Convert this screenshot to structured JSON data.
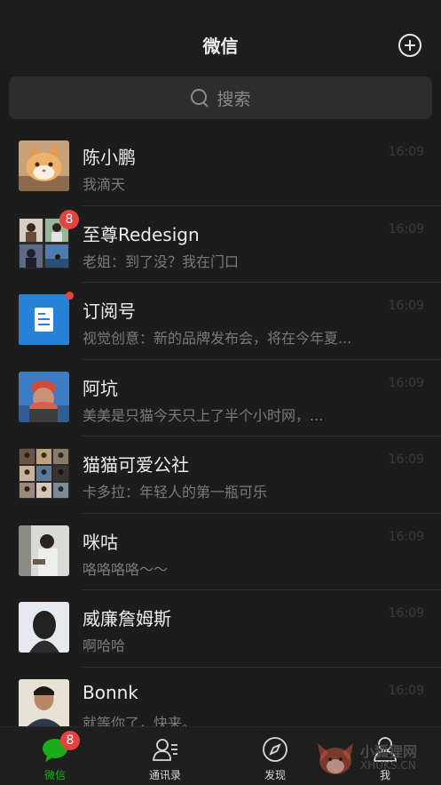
{
  "header": {
    "title": "微信"
  },
  "search": {
    "placeholder": "搜索"
  },
  "chats": [
    {
      "name": "陈小鹏",
      "message": "我滴天",
      "time": "16:09"
    },
    {
      "name": "至尊Redesign",
      "message": "老姐：到了没？我在门口",
      "time": "16:09",
      "badge": "8"
    },
    {
      "name": "订阅号",
      "message": "视觉创意：新的品牌发布会，将在今年夏...",
      "time": "16:09"
    },
    {
      "name": "阿坑",
      "message": "美美是只猫今天只上了半个小时网，...",
      "time": "16:09"
    },
    {
      "name": "猫猫可爱公社",
      "message": "卡多拉：年轻人的第一瓶可乐",
      "time": "16:09"
    },
    {
      "name": "咪咕",
      "message": "咯咯咯咯～～",
      "time": "16:09"
    },
    {
      "name": "威廉詹姆斯",
      "message": "啊哈哈",
      "time": "16:09"
    },
    {
      "name": "Bonnk",
      "message": "就等你了，快来。",
      "time": "16:09"
    }
  ],
  "tabs": [
    {
      "label": "微信",
      "badge": "8",
      "icon": "chat-bubble-icon",
      "active": true
    },
    {
      "label": "通讯录",
      "icon": "contacts-icon"
    },
    {
      "label": "发现",
      "icon": "compass-icon"
    },
    {
      "label": "我",
      "icon": "person-icon"
    }
  ],
  "watermark": {
    "line1": "小狐狸网",
    "line2": "XHUKS.CN"
  },
  "colors": {
    "accent": "#1aad19",
    "badge": "#e64340",
    "background": "#1c1c1c"
  }
}
